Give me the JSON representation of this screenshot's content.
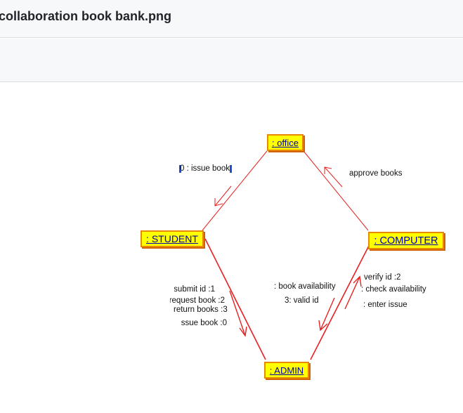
{
  "file": {
    "title": "collaboration book bank.png"
  },
  "nodes": {
    "office": ": office",
    "student": ": STUDENT",
    "computer": ": COMPUTER",
    "admin": ": ADMIN"
  },
  "messages": {
    "issue_book_top": "0 : issue book",
    "approve_books": "approve books",
    "submit_id": "1: submit id",
    "request_book": "2: request book",
    "return_books": "3: return books",
    "issue_book_bottom": "0: issue book",
    "book_availability": ": book availability",
    "valid_id": "3: valid id",
    "verify_id": "2: verify id",
    "check_availability": ": check availability",
    "enter_issue": ": enter issue"
  },
  "colors": {
    "link": "#e82020",
    "node_fill": "#ffff00",
    "node_border": "#e88a00",
    "node_text": "#0000aa"
  }
}
